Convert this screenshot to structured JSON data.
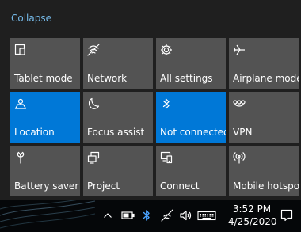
{
  "action_center": {
    "collapse_label": "Collapse",
    "colors": {
      "tile_inactive": "#535353",
      "tile_active": "#0078d7",
      "link": "#75b9e8"
    },
    "tiles": [
      {
        "label": "Tablet mode",
        "icon": "tablet-mode-icon",
        "active": false
      },
      {
        "label": "Network",
        "icon": "network-icon",
        "active": false
      },
      {
        "label": "All settings",
        "icon": "gear-icon",
        "active": false
      },
      {
        "label": "Airplane mode",
        "icon": "airplane-icon",
        "active": false
      },
      {
        "label": "Location",
        "icon": "location-icon",
        "active": true
      },
      {
        "label": "Focus assist",
        "icon": "moon-icon",
        "active": false
      },
      {
        "label": "Not connected",
        "icon": "bluetooth-icon",
        "active": true
      },
      {
        "label": "VPN",
        "icon": "vpn-icon",
        "active": false
      },
      {
        "label": "Battery saver",
        "icon": "battery-saver-icon",
        "active": false
      },
      {
        "label": "Project",
        "icon": "project-icon",
        "active": false
      },
      {
        "label": "Connect",
        "icon": "connect-icon",
        "active": false
      },
      {
        "label": "Mobile hotspot",
        "icon": "mobile-hotspot-icon",
        "active": false
      }
    ]
  },
  "taskbar": {
    "tray_icons": [
      "chevron-up-icon",
      "battery-icon",
      "bluetooth-icon",
      "wifi-icon",
      "volume-icon",
      "keyboard-icon"
    ],
    "clock": {
      "time": "3:52 PM",
      "date": "4/25/2020"
    },
    "notification_icon": "notification-icon"
  }
}
